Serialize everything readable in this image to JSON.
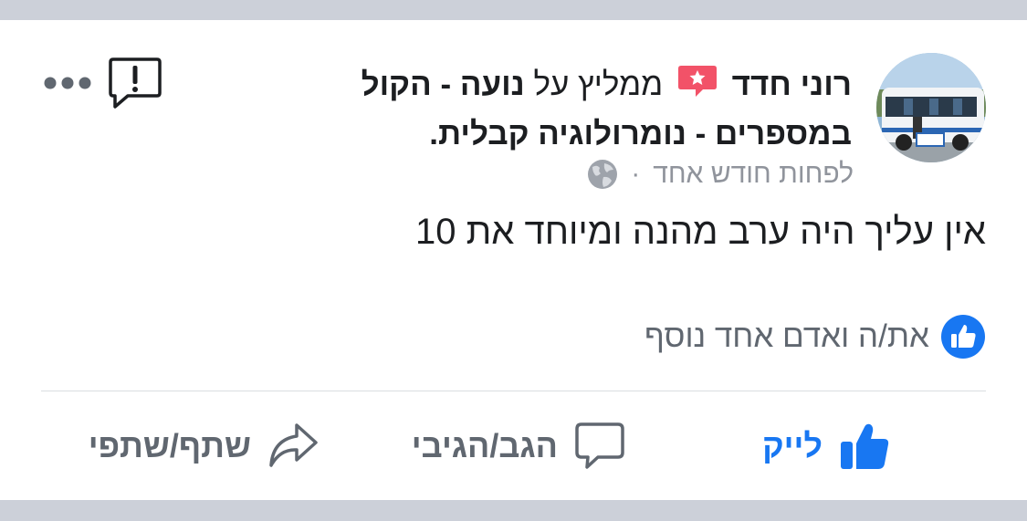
{
  "post": {
    "author": "רוני חדד",
    "recommends_text": "ממליץ על",
    "page_name": "נועה - הקול במספרים - נומרולוגיה קבלית.",
    "timestamp": "לפחות חודש אחד",
    "separator": "·",
    "body": "אין עליך היה ערב מהנה ומיוחד את 10",
    "reactions_text": "את/ה ואדם אחד נוסף"
  },
  "actions": {
    "like_label": "לייק",
    "comment_label": "הגב/הגיבי",
    "share_label": "שתף/שתפי"
  },
  "icons": {
    "recommend": "recommend-badge-icon",
    "globe": "globe-icon",
    "report": "report-icon",
    "more": "more-dots-icon",
    "like_reaction": "like-reaction-icon",
    "like": "thumbs-up-icon",
    "comment": "comment-icon",
    "share": "share-icon"
  },
  "colors": {
    "accent": "#1877f2",
    "recommend": "#f25268",
    "muted": "#90949c",
    "text": "#1c1e21",
    "background": "#ccd0d9"
  }
}
